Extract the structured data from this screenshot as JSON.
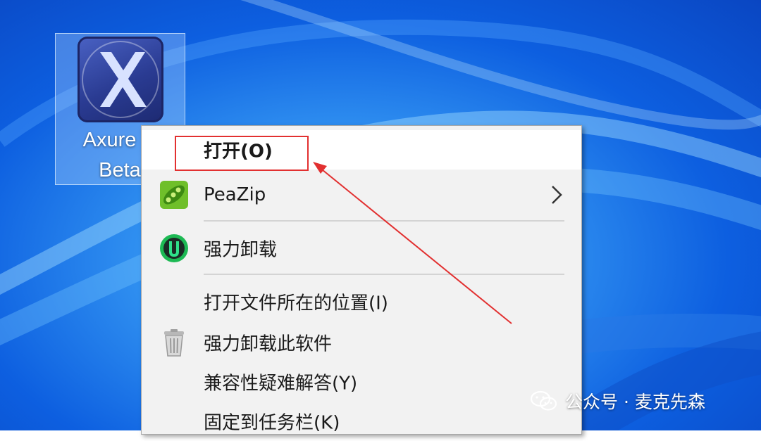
{
  "desktop": {
    "icon": {
      "name_line1": "Axure R",
      "name_line2": "Beta",
      "icon_name": "axure-rp-icon"
    }
  },
  "context_menu": {
    "items": [
      {
        "label": "打开(O)",
        "icon": null,
        "bold": true,
        "highlighted": true
      },
      {
        "label": "PeaZip",
        "icon": "peazip-icon",
        "submenu": true
      },
      {
        "label": "强力卸载",
        "icon": "iobit-uninstaller-icon"
      },
      {
        "label": "打开文件所在的位置(I)",
        "icon": null
      },
      {
        "label": "强力卸载此软件",
        "icon": "trash-can-icon"
      },
      {
        "label": "兼容性疑难解答(Y)",
        "icon": null
      },
      {
        "label": "固定到任务栏(K)",
        "icon": null
      }
    ]
  },
  "annotation": {
    "color": "#e23030",
    "target": "打开(O)"
  },
  "watermark": {
    "text": "公众号 · 麦克先森",
    "icon": "wechat-icon"
  }
}
